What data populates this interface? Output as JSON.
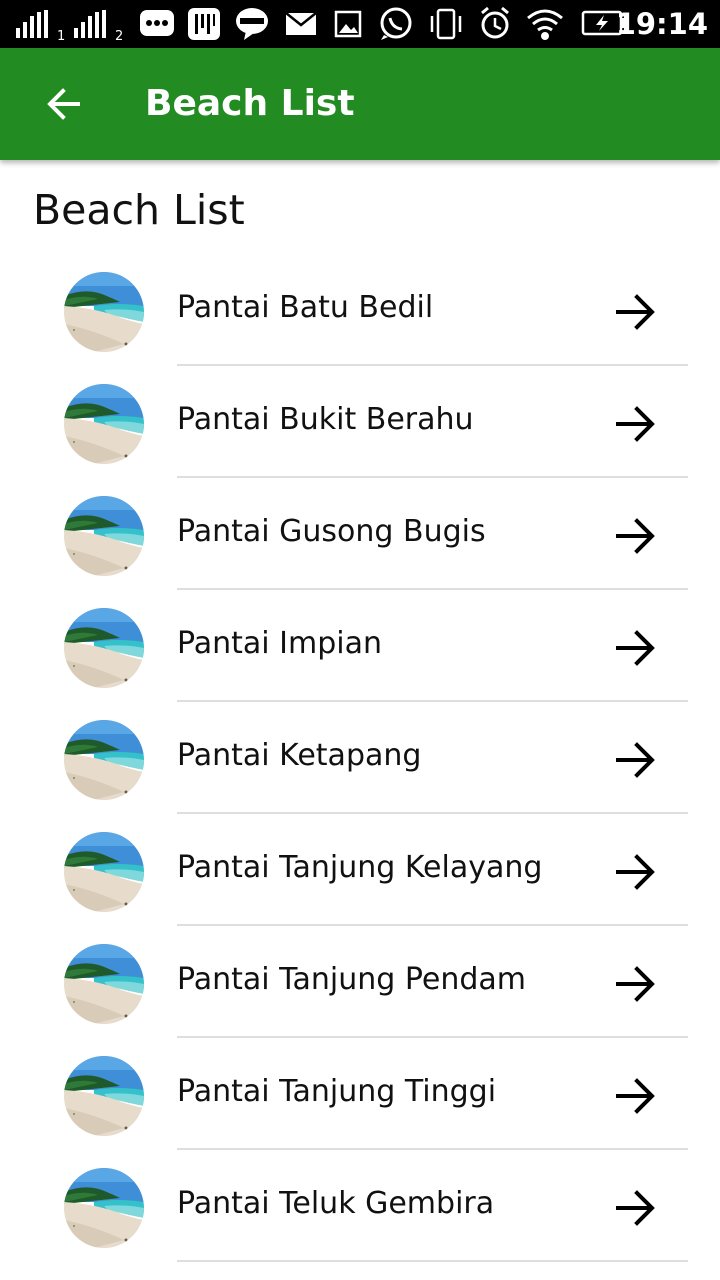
{
  "status_bar": {
    "time": "19:14",
    "sim1_label": "1",
    "sim2_label": "2",
    "icons": [
      "signal-sim1-icon",
      "signal-sim2-icon",
      "chat-bubble-icon",
      "app-icon",
      "line-icon",
      "mail-icon",
      "image-icon",
      "whatsapp-icon",
      "vibrate-icon",
      "alarm-icon",
      "wifi-icon",
      "battery-charging-icon"
    ]
  },
  "app_bar": {
    "title": "Beach List",
    "back_icon": "arrow-left-icon",
    "background_color": "#228b22"
  },
  "page": {
    "heading": "Beach List"
  },
  "beaches": [
    {
      "name": "Pantai Batu Bedil"
    },
    {
      "name": "Pantai Bukit Berahu"
    },
    {
      "name": "Pantai Gusong Bugis"
    },
    {
      "name": "Pantai Impian"
    },
    {
      "name": "Pantai Ketapang"
    },
    {
      "name": "Pantai Tanjung Kelayang"
    },
    {
      "name": "Pantai Tanjung Pendam"
    },
    {
      "name": "Pantai Tanjung Tinggi"
    },
    {
      "name": "Pantai Teluk Gembira"
    }
  ],
  "row_icon": "arrow-right-icon"
}
